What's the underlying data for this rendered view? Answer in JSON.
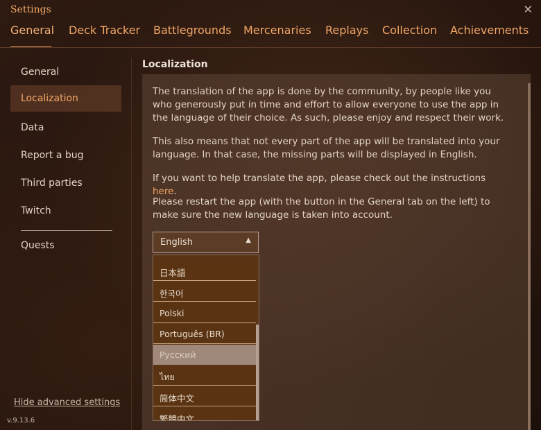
{
  "app": {
    "title": "Settings",
    "close_glyph": "✕"
  },
  "tabs": [
    {
      "label": "General"
    },
    {
      "label": "Deck Tracker"
    },
    {
      "label": "Battlegrounds"
    },
    {
      "label": "Mercenaries"
    },
    {
      "label": "Replays"
    },
    {
      "label": "Collection"
    },
    {
      "label": "Achievements"
    }
  ],
  "active_tab": "General",
  "sidebar": {
    "items": [
      {
        "label": "General"
      },
      {
        "label": "Localization"
      },
      {
        "label": "Data"
      },
      {
        "label": "Report a bug"
      },
      {
        "label": "Third parties"
      },
      {
        "label": "Twitch"
      },
      {
        "label": "Quests"
      }
    ],
    "selected": "Localization",
    "advanced_link": "Hide advanced settings",
    "version": "v.9.13.6"
  },
  "content": {
    "title": "Localization",
    "para1": "The translation of the app is done by the community, by people like you who generously put in time and effort to allow everyone to use the app in the language of their choice. As such, please enjoy and respect their work.",
    "para2": "This also means that not every part of the app will be translated into your language. In that case, the missing parts will be displayed in English.",
    "para3_prefix": "If you want to help translate the app, please check out the instructions ",
    "para3_link": "here",
    "para3_suffix": ".",
    "para4": "Please restart the app (with the button in the General tab on the left) to make sure the new language is taken into account."
  },
  "language_select": {
    "value": "English",
    "caret_icon": "caret-up-icon",
    "options": [
      {
        "label": "日本語"
      },
      {
        "label": "한국어"
      },
      {
        "label": "Polski"
      },
      {
        "label": "Português (BR)"
      },
      {
        "label": "Русский"
      },
      {
        "label": "ไทย"
      },
      {
        "label": "简体中文"
      },
      {
        "label": "繁體中文"
      }
    ],
    "hovered": "Русский"
  },
  "colors": {
    "accent": "#f2a766",
    "background": "#24140d",
    "panel": "#5f4637",
    "dropdown_bg": "#5a3412",
    "hover_bg": "#a0897a"
  }
}
